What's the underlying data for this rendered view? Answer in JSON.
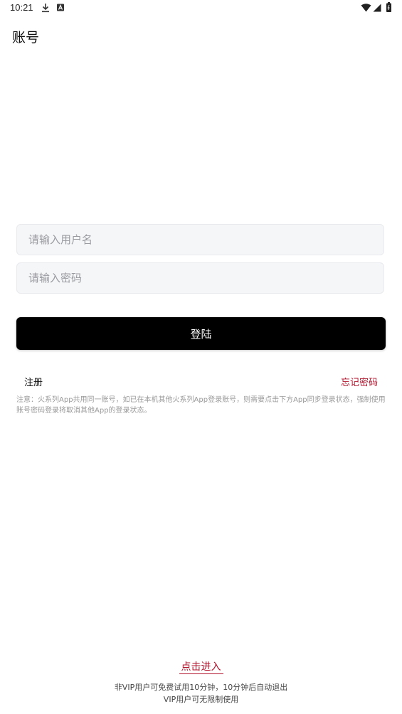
{
  "status_bar": {
    "time": "10:21",
    "icons": [
      "download-icon",
      "a-notification-icon",
      "wifi-icon",
      "signal-icon",
      "battery-icon"
    ]
  },
  "header": {
    "title": "账号"
  },
  "form": {
    "username_placeholder": "请输入用户名",
    "password_placeholder": "请输入密码",
    "login_label": "登陆",
    "register_label": "注册",
    "forgot_label": "忘记密码"
  },
  "notice": "注意：火系列App共用同一账号，如已在本机其他火系列App登录账号，则需要点击下方App同步登录状态，强制使用账号密码登录将取消其他App的登录状态。",
  "footer": {
    "enter_label": "点击进入",
    "line1": "非VIP用户可免费试用10分钟，10分钟后自动退出",
    "line2": "VIP用户可无限制使用"
  },
  "colors": {
    "accent": "#b0132b",
    "button_bg": "#000000",
    "input_bg": "#f5f6f8"
  }
}
